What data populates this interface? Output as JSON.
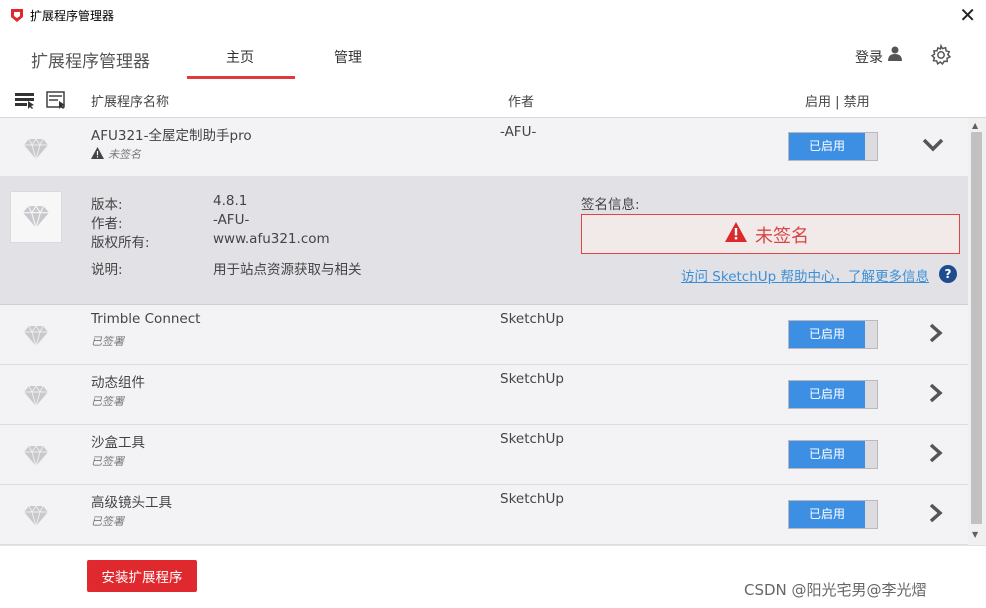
{
  "window": {
    "title": "扩展程序管理器",
    "close_label": "✕"
  },
  "nav": {
    "app_name": "扩展程序管理器",
    "tabs": [
      {
        "label": "主页",
        "active": true
      },
      {
        "label": "管理",
        "active": false
      }
    ],
    "login_label": "登录"
  },
  "table_header": {
    "name": "扩展程序名称",
    "author": "作者",
    "enable_disable": "启用 | 禁用"
  },
  "extensions": [
    {
      "name": "AFU321-全屋定制助手pro",
      "signature": "未签名",
      "author": "-AFU-",
      "toggle_label": "已启用",
      "expanded": true,
      "details": {
        "version_label": "版本:",
        "version": "4.8.1",
        "author_label": "作者:",
        "author": "-AFU-",
        "copyright_label": "版权所有:",
        "copyright": "www.afu321.com",
        "description_label": "说明:",
        "description": "用于站点资源获取与相关",
        "signature_info_label": "签名信息:",
        "signature_status": "未签名",
        "help_link": "访问 SketchUp 帮助中心，了解更多信息"
      }
    },
    {
      "name": "Trimble Connect",
      "signature": "已签署",
      "author": "SketchUp",
      "toggle_label": "已启用",
      "expanded": false
    },
    {
      "name": "动态组件",
      "signature": "已签署",
      "author": "SketchUp",
      "toggle_label": "已启用",
      "expanded": false
    },
    {
      "name": "沙盒工具",
      "signature": "已签署",
      "author": "SketchUp",
      "toggle_label": "已启用",
      "expanded": false
    },
    {
      "name": "高级镜头工具",
      "signature": "已签署",
      "author": "SketchUp",
      "toggle_label": "已启用",
      "expanded": false
    }
  ],
  "footer": {
    "install_button": "安装扩展程序",
    "watermark": "CSDN @阳光宅男@李光熠"
  },
  "colors": {
    "accent_red": "#e03b3b",
    "toggle_blue": "#3d8fe4",
    "warning_red": "#d64646",
    "link_blue": "#3c8fd6"
  },
  "icons": [
    "sketchup-logo-icon",
    "close-icon",
    "user-icon",
    "gear-icon",
    "list-view-icon",
    "detail-view-icon",
    "ruby-gem-icon",
    "warning-icon",
    "chevron-down-icon",
    "chevron-right-icon",
    "help-icon"
  ]
}
